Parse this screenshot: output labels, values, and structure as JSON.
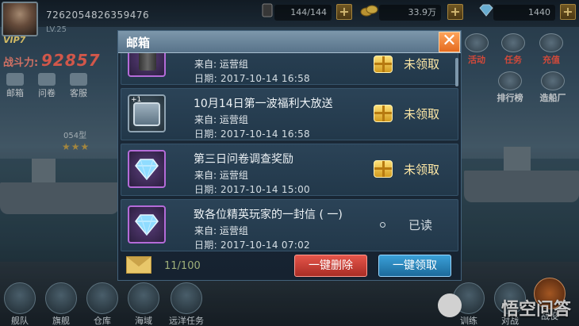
{
  "player": {
    "id": "7262054826359476",
    "vip": "VIP7",
    "level": "LV.25",
    "power_label": "战斗力:",
    "power_value": "92857"
  },
  "resources": {
    "fuel": "144/144",
    "gold": "33.9万",
    "diamonds": "1440"
  },
  "left_menu": [
    {
      "label": "邮箱",
      "icon": "mail-icon"
    },
    {
      "label": "问卷",
      "icon": "survey-icon"
    },
    {
      "label": "客服",
      "icon": "service-icon"
    }
  ],
  "ship": {
    "tag": "054型",
    "stars": "★★★"
  },
  "right_menu": [
    {
      "label": "活动",
      "icon": "event-icon"
    },
    {
      "label": "任务",
      "icon": "task-icon"
    },
    {
      "label": "充值",
      "icon": "recharge-icon"
    },
    {
      "label": "排行榜",
      "icon": "ranking-icon"
    },
    {
      "label": "造船厂",
      "icon": "shipyard-icon"
    }
  ],
  "bottom_menu": [
    {
      "label": "舰队",
      "icon": "fleet-icon"
    },
    {
      "label": "旗舰",
      "icon": "flagship-icon"
    },
    {
      "label": "仓库",
      "icon": "warehouse-icon"
    },
    {
      "label": "海域",
      "icon": "sea-icon"
    },
    {
      "label": "远洋任务",
      "icon": "ocean-mission-icon"
    },
    {
      "label": "训练",
      "icon": "training-icon"
    },
    {
      "label": "对战",
      "icon": "battle-icon"
    },
    {
      "label": "战役",
      "icon": "campaign-icon"
    }
  ],
  "watermark": "悟空问答",
  "mailbox": {
    "title": "邮箱",
    "close": "✕",
    "mails": [
      {
        "title": "",
        "from": "来自: 运营组",
        "date": "日期: 2017-10-14 16:58",
        "status": "未领取",
        "attachment": "oil-icon"
      },
      {
        "title": "10月14日第一波福利大放送",
        "from": "来自: 运营组",
        "date": "日期: 2017-10-14 16:58",
        "status": "未领取",
        "attachment": "chest-icon",
        "badge": "+1"
      },
      {
        "title": "第三日问卷调查奖励",
        "from": "来自: 运营组",
        "date": "日期: 2017-10-14 15:00",
        "status": "未领取",
        "attachment": "diamond-icon"
      },
      {
        "title": "致各位精英玩家的一封信 ( 一)",
        "from": "来自: 运营组",
        "date": "日期: 2017-10-14 07:02",
        "status": "已读",
        "attachment": "diamond-icon"
      }
    ],
    "count": "11/100",
    "delete_all": "一键删除",
    "claim_all": "一键领取"
  }
}
